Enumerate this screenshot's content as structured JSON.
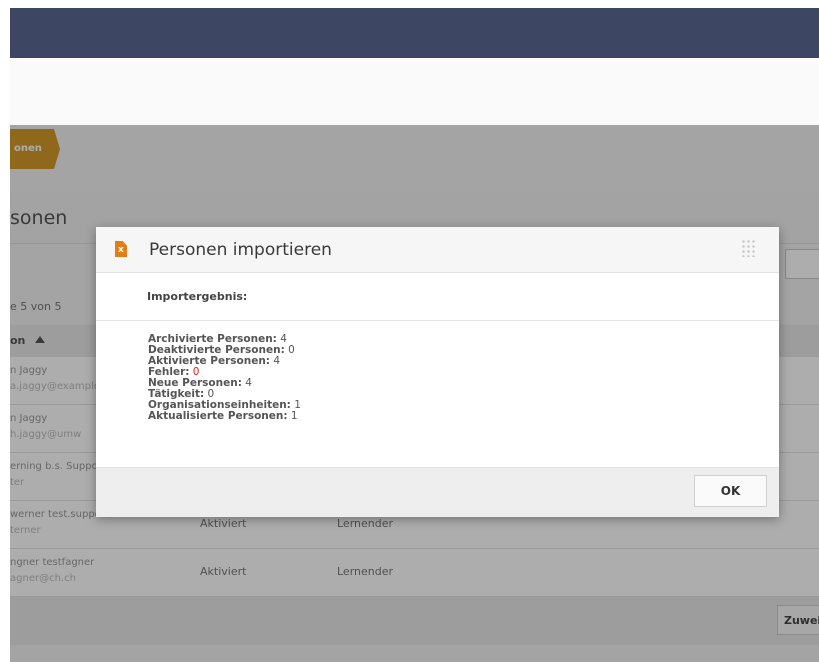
{
  "breadcrumb": {
    "label": "onen"
  },
  "panel": {
    "title": "sonen",
    "counter": "e 5 von 5",
    "column_header": "on",
    "assign_button": "Zuwei"
  },
  "rows": [
    {
      "name": "n Jaggy",
      "detail": "a.jaggy@example",
      "status": "",
      "role": ""
    },
    {
      "name": "n Jaggy",
      "detail": "h.jaggy@umw",
      "status": "",
      "role": ""
    },
    {
      "name": "erning b.s. Support",
      "detail": "ter",
      "status": "",
      "role": ""
    },
    {
      "name": "werner test.support",
      "detail": "terner",
      "status": "Aktiviert",
      "role": "Lernender"
    },
    {
      "name": "ngner testfagner",
      "detail": "agner@ch.ch",
      "status": "Aktiviert",
      "role": "Lernender"
    }
  ],
  "dialog": {
    "title": "Personen importieren",
    "result_label": "Importergebnis:",
    "stats": [
      {
        "label": "Archivierte Personen:",
        "value": "4"
      },
      {
        "label": "Deaktivierte Personen:",
        "value": "0"
      },
      {
        "label": "Aktivierte Personen:",
        "value": "4"
      },
      {
        "label": "Fehler:",
        "value": "0"
      },
      {
        "label": "Neue Personen:",
        "value": "4"
      },
      {
        "label": "Tätigkeit:",
        "value": "0"
      },
      {
        "label": "Organisationseinheiten:",
        "value": "1"
      },
      {
        "label": "Aktualisierte Personen:",
        "value": "1"
      }
    ],
    "ok_label": "OK"
  },
  "colors": {
    "topbar": "#3d4763",
    "accent": "#d49a2a",
    "file_icon": "#e07e18",
    "error": "#e52020"
  },
  "icons": {
    "file": "file-excel-icon",
    "sort": "sort-asc-icon",
    "drag": "drag-handle-icon"
  }
}
